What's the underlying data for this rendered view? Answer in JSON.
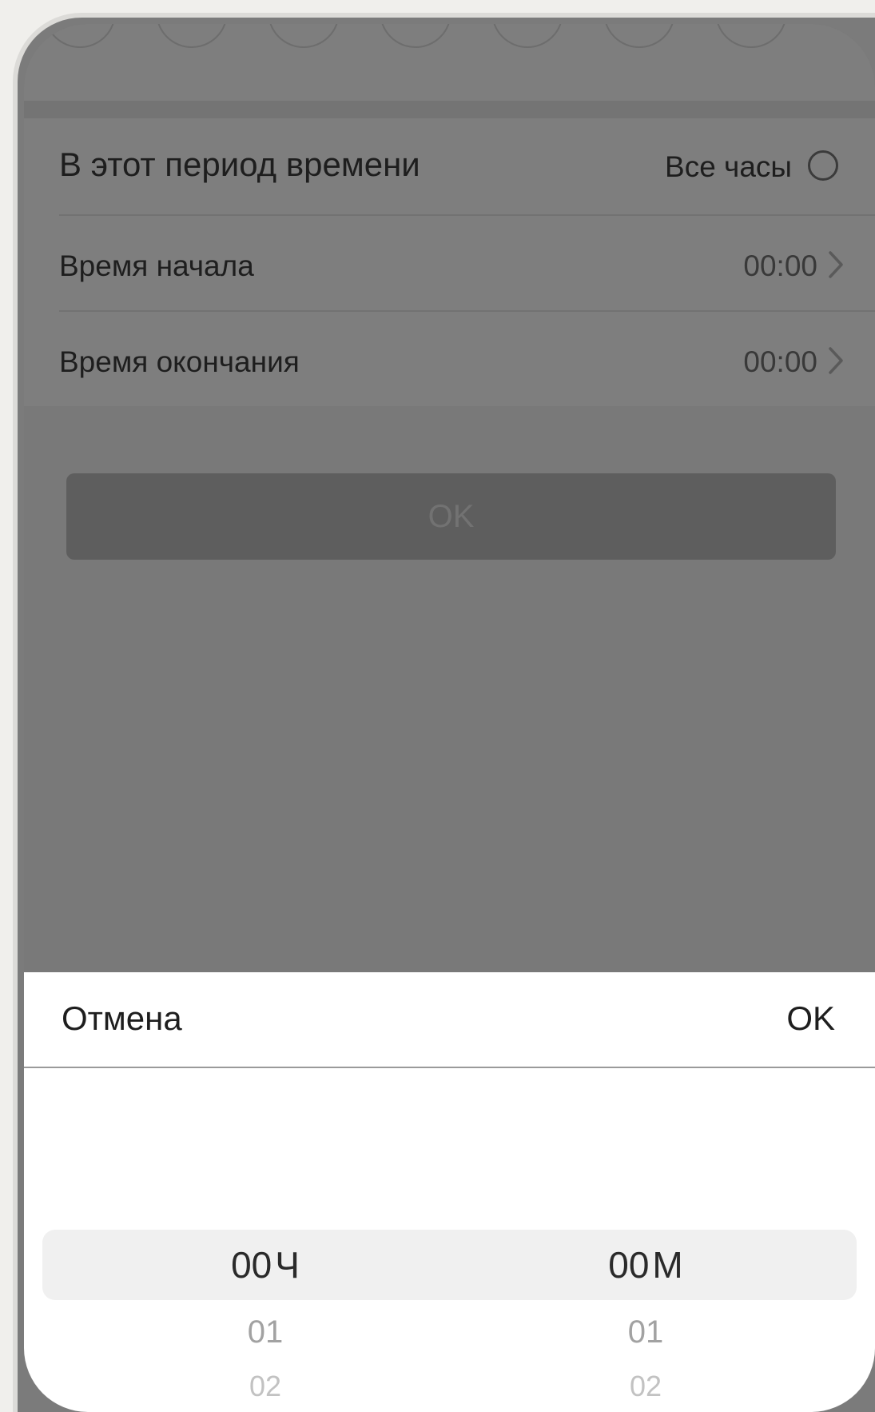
{
  "settings": {
    "period_label": "В этот период времени",
    "all_hours_label": "Все часы",
    "start_label": "Время начала",
    "start_value": "00:00",
    "end_label": "Время окончания",
    "end_value": "00:00",
    "ok_label": "OK"
  },
  "sheet": {
    "cancel_label": "Отмена",
    "ok_label": "OK"
  },
  "picker": {
    "hours": {
      "selected": "00",
      "unit": "Ч",
      "next": "01",
      "next2": "02"
    },
    "minutes": {
      "selected": "00",
      "unit": "M",
      "next": "01",
      "next2": "02"
    }
  },
  "colors": {
    "overlay": "#797979",
    "sheet_background": "#ffffff",
    "picker_highlight": "#f0f0f0"
  }
}
